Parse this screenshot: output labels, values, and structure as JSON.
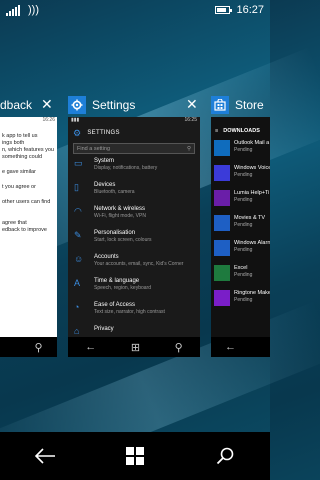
{
  "status": {
    "time": "16:27"
  },
  "cards": {
    "left": {
      "title": "dback",
      "mini_time": "16:26",
      "lines": [
        "k app to tell us",
        "ings both",
        "n, which features you",
        "something could",
        "e gave similar",
        "t you agree or",
        "other users can find",
        "agree that",
        "edback to improve"
      ]
    },
    "settings": {
      "title": "Settings",
      "mini_time": "16:25",
      "heading": "SETTINGS",
      "search_placeholder": "Find a setting",
      "items": [
        {
          "title": "System",
          "sub": "Display, notifications, battery",
          "icon": "system-icon"
        },
        {
          "title": "Devices",
          "sub": "Bluetooth, camera",
          "icon": "devices-icon"
        },
        {
          "title": "Network & wireless",
          "sub": "Wi-Fi, flight mode, VPN",
          "icon": "network-icon"
        },
        {
          "title": "Personalisation",
          "sub": "Start, lock screen, colours",
          "icon": "personalisation-icon"
        },
        {
          "title": "Accounts",
          "sub": "Your accounts, email, sync, Kid's Corner",
          "icon": "accounts-icon"
        },
        {
          "title": "Time & language",
          "sub": "Speech, region, keyboard",
          "icon": "time-language-icon"
        },
        {
          "title": "Ease of Access",
          "sub": "Text size, narrator, high contrast",
          "icon": "ease-of-access-icon"
        },
        {
          "title": "Privacy",
          "sub": "",
          "icon": "privacy-icon"
        }
      ]
    },
    "store": {
      "title": "Store",
      "heading": "DOWNLOADS",
      "items": [
        {
          "title": "Outlook Mail a",
          "status": "Pending",
          "color": "#0f6cbd"
        },
        {
          "title": "Windows Voice",
          "status": "Pending",
          "color": "#3b3bd9"
        },
        {
          "title": "Lumia Help+Ti",
          "status": "Pending",
          "color": "#6a1ea8"
        },
        {
          "title": "Movies & TV",
          "status": "Pending",
          "color": "#1e5fc4"
        },
        {
          "title": "Windows Alarn",
          "status": "Pending",
          "color": "#1e5fc4"
        },
        {
          "title": "Excel",
          "status": "Pending",
          "color": "#1e7a3e"
        },
        {
          "title": "Ringtone Make",
          "status": "Pending",
          "color": "#7a1ec8"
        }
      ]
    }
  }
}
